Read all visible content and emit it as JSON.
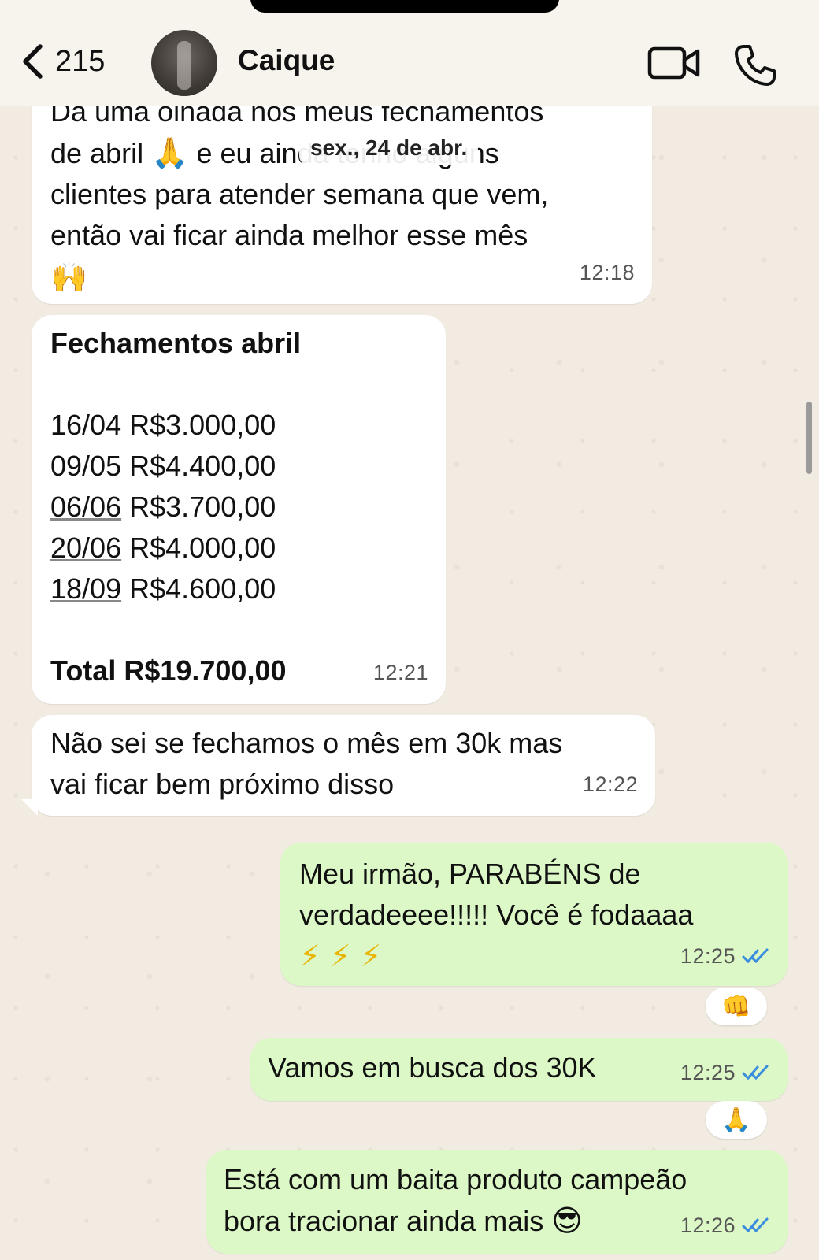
{
  "header": {
    "back_count": "215",
    "contact_name": "Caique",
    "icons": [
      "chevron-left-icon",
      "video-call-icon",
      "phone-icon"
    ]
  },
  "date_chip": "sex., 24 de abr.",
  "messages": {
    "m1": {
      "lines": [
        "Dá uma olhada nos meus fechamentos",
        "de abril",
        "e eu ainda tenho alguns",
        "clientes para atender semana que vem,",
        "então vai ficar ainda melhor esse mês"
      ],
      "emoji_pray": "🙏",
      "emoji_hands": "🙌",
      "time": "12:18"
    },
    "m2": {
      "title": "Fechamentos abril",
      "rows": [
        {
          "date": "16/04",
          "value": "R$3.000,00"
        },
        {
          "date": "09/05",
          "value": "R$4.400,00"
        },
        {
          "date": "06/06",
          "value": "R$3.700,00"
        },
        {
          "date": "20/06",
          "value": "R$4.000,00"
        },
        {
          "date": "18/09",
          "value": "R$4.600,00"
        }
      ],
      "total": "Total R$19.700,00",
      "time": "12:21"
    },
    "m3": {
      "lines": [
        "Não sei se fechamos o mês em 30k mas",
        "vai ficar bem próximo disso"
      ],
      "time": "12:22"
    },
    "m4": {
      "lines": [
        "Meu irmão, PARABÉNS de",
        "verdadeeee!!!!!  Você é fodaaaa"
      ],
      "emoji": "⚡ ⚡ ⚡",
      "time": "12:25",
      "reaction": "👊"
    },
    "m5": {
      "text": "Vamos em busca dos 30K",
      "time": "12:25",
      "reaction": "🙏"
    },
    "m6": {
      "lines": [
        "Está com um baita produto campeão",
        "bora tracionar ainda mais"
      ],
      "emoji": "😎",
      "time": "12:26"
    }
  },
  "colors": {
    "incoming_bubble": "#ffffff",
    "outgoing_bubble": "#dcf8c6",
    "read_ticks": "#3a8dde",
    "chat_background": "#f1ebe2"
  }
}
